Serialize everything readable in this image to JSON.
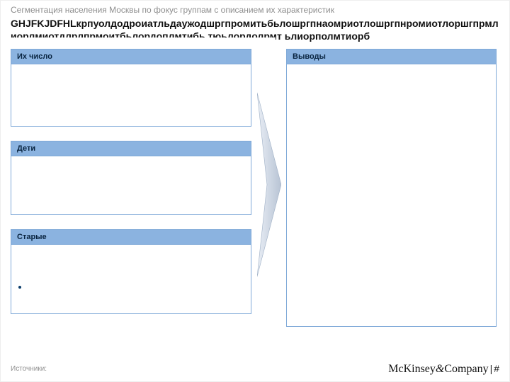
{
  "tracker": "Сегментация населения Москвы по фокус группам с описанием их характеристик",
  "headline": "GHJFKJDFHLкрпуолдодроиатльдаужодшргпромитьбьлошргпнаомриотлошргпнромиотлоршгпрмлиорлмиотдлрлпрмоитбьлордоплмтибь тюьлордолрмт ьлиорполмтиорб",
  "left": {
    "panels": [
      {
        "title": "Их число"
      },
      {
        "title": "Дети"
      },
      {
        "title": "Старые"
      }
    ]
  },
  "right": {
    "title": "Выводы"
  },
  "source_label": "Источники:",
  "brand": {
    "name_a": "McKinsey",
    "name_b": "Company",
    "page": "#"
  }
}
